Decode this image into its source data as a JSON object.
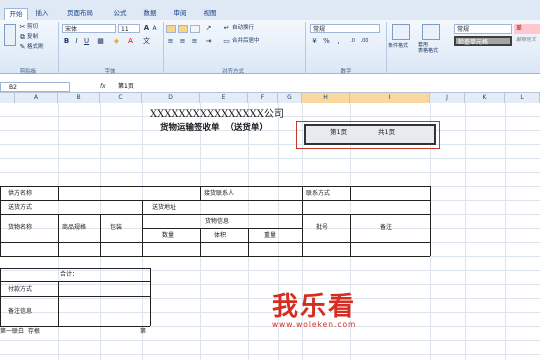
{
  "tabs": [
    "开始",
    "插入",
    "页面布局",
    "公式",
    "数据",
    "审阅",
    "视图"
  ],
  "ribbon": {
    "clipboard": {
      "cut": "剪切",
      "copy": "复制",
      "format_painter": "格式刷",
      "paste_icon": "paste-icon"
    },
    "font": {
      "name": "宋体",
      "size": "11",
      "bold": "B",
      "italic": "I",
      "underline": "U",
      "grow": "A",
      "shrink": "A",
      "wen": "文"
    },
    "alignment": {
      "wrap": "自动换行",
      "merge": "合并后居中"
    },
    "number": {
      "format": "常规",
      "percent": "%",
      "comma": ","
    },
    "styles": {
      "cond_format": "条件格式",
      "table_format": "套用\n表格格式",
      "normal": "常规",
      "bad": "差",
      "check": "检查单元格",
      "explain": "解释性文"
    },
    "group_labels": {
      "clipboard": "剪贴板",
      "font": "字体",
      "alignment": "对齐方式",
      "number": "数字"
    }
  },
  "formula_bar": {
    "name_box": "B2",
    "fx": "fx",
    "content": "第1页"
  },
  "columns": [
    "A",
    "B",
    "C",
    "D",
    "E",
    "F",
    "G",
    "H",
    "I",
    "J",
    "K",
    "L"
  ],
  "sheet": {
    "company": "XXXXXXXXXXXXXXXX公司",
    "title": "货物运输签收单  （送货单）",
    "page": "第1页",
    "total": "共1页",
    "supplier": "供方名称",
    "contact": "接货联系人",
    "contact_method": "联系方式",
    "delivery_method": "送货方式",
    "delivery_address": "送货地址",
    "goods_name": "货物名称",
    "spec": "商品规格",
    "package": "包装",
    "goods_info": "货物信息",
    "qty": "数量",
    "volume": "体积",
    "weight": "重量",
    "batch": "批号",
    "remark": "备注",
    "total_label": "合计：",
    "payment": "付款方式",
    "remark_info": "备注信息",
    "footer": "第一联白  存根",
    "footer_right": "第"
  },
  "watermark": {
    "text": "我乐看",
    "site": "www.woleken.com"
  },
  "colors": {
    "ribbon": "#dfe8f5",
    "header": "#e4ecf7",
    "watermark": "#d62d20"
  }
}
